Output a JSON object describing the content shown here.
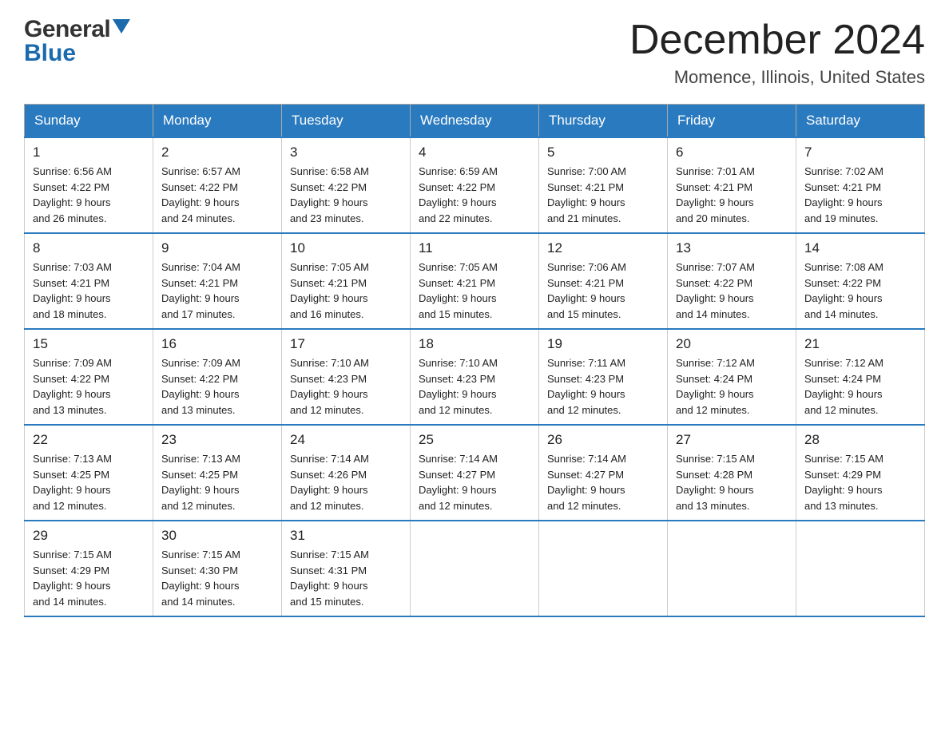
{
  "header": {
    "logo_general": "General",
    "logo_blue": "Blue",
    "title": "December 2024",
    "location": "Momence, Illinois, United States"
  },
  "calendar": {
    "days_of_week": [
      "Sunday",
      "Monday",
      "Tuesday",
      "Wednesday",
      "Thursday",
      "Friday",
      "Saturday"
    ],
    "weeks": [
      [
        {
          "day": "1",
          "sunrise": "6:56 AM",
          "sunset": "4:22 PM",
          "daylight": "9 hours and 26 minutes."
        },
        {
          "day": "2",
          "sunrise": "6:57 AM",
          "sunset": "4:22 PM",
          "daylight": "9 hours and 24 minutes."
        },
        {
          "day": "3",
          "sunrise": "6:58 AM",
          "sunset": "4:22 PM",
          "daylight": "9 hours and 23 minutes."
        },
        {
          "day": "4",
          "sunrise": "6:59 AM",
          "sunset": "4:22 PM",
          "daylight": "9 hours and 22 minutes."
        },
        {
          "day": "5",
          "sunrise": "7:00 AM",
          "sunset": "4:21 PM",
          "daylight": "9 hours and 21 minutes."
        },
        {
          "day": "6",
          "sunrise": "7:01 AM",
          "sunset": "4:21 PM",
          "daylight": "9 hours and 20 minutes."
        },
        {
          "day": "7",
          "sunrise": "7:02 AM",
          "sunset": "4:21 PM",
          "daylight": "9 hours and 19 minutes."
        }
      ],
      [
        {
          "day": "8",
          "sunrise": "7:03 AM",
          "sunset": "4:21 PM",
          "daylight": "9 hours and 18 minutes."
        },
        {
          "day": "9",
          "sunrise": "7:04 AM",
          "sunset": "4:21 PM",
          "daylight": "9 hours and 17 minutes."
        },
        {
          "day": "10",
          "sunrise": "7:05 AM",
          "sunset": "4:21 PM",
          "daylight": "9 hours and 16 minutes."
        },
        {
          "day": "11",
          "sunrise": "7:05 AM",
          "sunset": "4:21 PM",
          "daylight": "9 hours and 15 minutes."
        },
        {
          "day": "12",
          "sunrise": "7:06 AM",
          "sunset": "4:21 PM",
          "daylight": "9 hours and 15 minutes."
        },
        {
          "day": "13",
          "sunrise": "7:07 AM",
          "sunset": "4:22 PM",
          "daylight": "9 hours and 14 minutes."
        },
        {
          "day": "14",
          "sunrise": "7:08 AM",
          "sunset": "4:22 PM",
          "daylight": "9 hours and 14 minutes."
        }
      ],
      [
        {
          "day": "15",
          "sunrise": "7:09 AM",
          "sunset": "4:22 PM",
          "daylight": "9 hours and 13 minutes."
        },
        {
          "day": "16",
          "sunrise": "7:09 AM",
          "sunset": "4:22 PM",
          "daylight": "9 hours and 13 minutes."
        },
        {
          "day": "17",
          "sunrise": "7:10 AM",
          "sunset": "4:23 PM",
          "daylight": "9 hours and 12 minutes."
        },
        {
          "day": "18",
          "sunrise": "7:10 AM",
          "sunset": "4:23 PM",
          "daylight": "9 hours and 12 minutes."
        },
        {
          "day": "19",
          "sunrise": "7:11 AM",
          "sunset": "4:23 PM",
          "daylight": "9 hours and 12 minutes."
        },
        {
          "day": "20",
          "sunrise": "7:12 AM",
          "sunset": "4:24 PM",
          "daylight": "9 hours and 12 minutes."
        },
        {
          "day": "21",
          "sunrise": "7:12 AM",
          "sunset": "4:24 PM",
          "daylight": "9 hours and 12 minutes."
        }
      ],
      [
        {
          "day": "22",
          "sunrise": "7:13 AM",
          "sunset": "4:25 PM",
          "daylight": "9 hours and 12 minutes."
        },
        {
          "day": "23",
          "sunrise": "7:13 AM",
          "sunset": "4:25 PM",
          "daylight": "9 hours and 12 minutes."
        },
        {
          "day": "24",
          "sunrise": "7:14 AM",
          "sunset": "4:26 PM",
          "daylight": "9 hours and 12 minutes."
        },
        {
          "day": "25",
          "sunrise": "7:14 AM",
          "sunset": "4:27 PM",
          "daylight": "9 hours and 12 minutes."
        },
        {
          "day": "26",
          "sunrise": "7:14 AM",
          "sunset": "4:27 PM",
          "daylight": "9 hours and 12 minutes."
        },
        {
          "day": "27",
          "sunrise": "7:15 AM",
          "sunset": "4:28 PM",
          "daylight": "9 hours and 13 minutes."
        },
        {
          "day": "28",
          "sunrise": "7:15 AM",
          "sunset": "4:29 PM",
          "daylight": "9 hours and 13 minutes."
        }
      ],
      [
        {
          "day": "29",
          "sunrise": "7:15 AM",
          "sunset": "4:29 PM",
          "daylight": "9 hours and 14 minutes."
        },
        {
          "day": "30",
          "sunrise": "7:15 AM",
          "sunset": "4:30 PM",
          "daylight": "9 hours and 14 minutes."
        },
        {
          "day": "31",
          "sunrise": "7:15 AM",
          "sunset": "4:31 PM",
          "daylight": "9 hours and 15 minutes."
        },
        null,
        null,
        null,
        null
      ]
    ],
    "labels": {
      "sunrise": "Sunrise:",
      "sunset": "Sunset:",
      "daylight": "Daylight:"
    }
  }
}
